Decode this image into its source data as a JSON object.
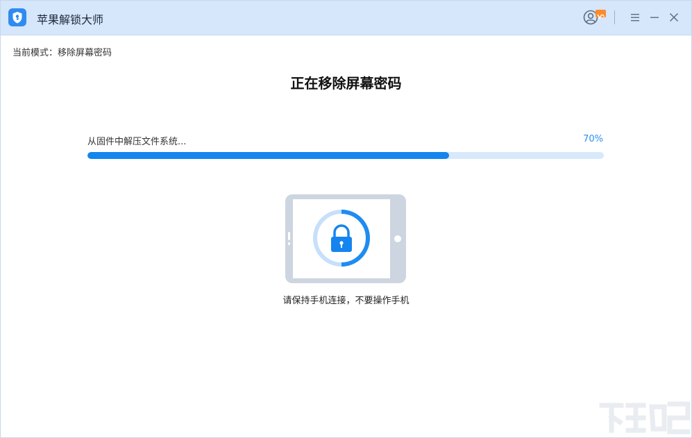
{
  "app": {
    "title": "苹果解锁大师"
  },
  "titlebar": {
    "icons": [
      "unlock-logo-icon",
      "user-account-icon",
      "vip-badge-icon",
      "menu-icon",
      "minimize-icon",
      "close-icon"
    ]
  },
  "mode": {
    "label": "当前模式：",
    "value": "移除屏幕密码"
  },
  "headline": "正在移除屏幕密码",
  "progress": {
    "label": "从固件中解压文件系统...",
    "percent_text": "70%",
    "value": 0.7
  },
  "hint": "请保持手机连接，不要操作手机",
  "colors": {
    "titlebar_bg": "#d6e6fb",
    "accent": "#1485ef",
    "track": "#d8e9fc",
    "percent_text": "#2a8ef0",
    "badge": "#ff8a2a"
  }
}
